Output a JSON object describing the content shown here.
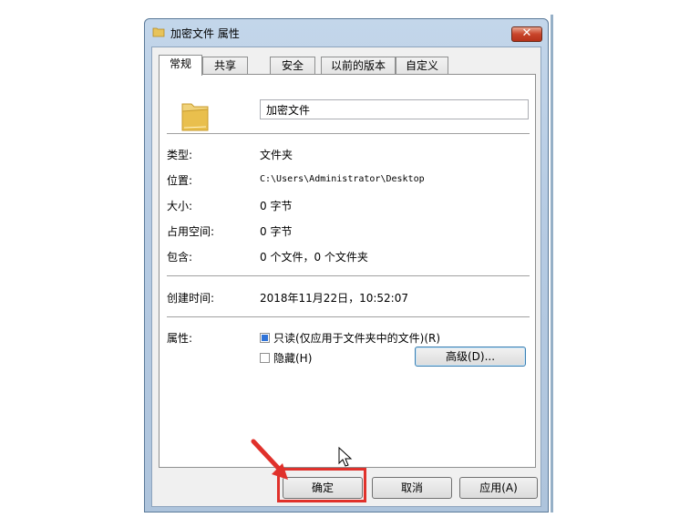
{
  "window": {
    "title": "加密文件 属性",
    "close_label": "✕"
  },
  "tabs": [
    {
      "label": "常规"
    },
    {
      "label": "共享"
    },
    {
      "label": "安全"
    },
    {
      "label": "以前的版本"
    },
    {
      "label": "自定义"
    }
  ],
  "general": {
    "folder_name": "加密文件",
    "type_label": "类型:",
    "type_value": "文件夹",
    "location_label": "位置:",
    "location_value": "C:\\Users\\Administrator\\Desktop",
    "size_label": "大小:",
    "size_value": "0 字节",
    "size_on_disk_label": "占用空间:",
    "size_on_disk_value": "0 字节",
    "contains_label": "包含:",
    "contains_value": "0 个文件，0 个文件夹",
    "created_label": "创建时间:",
    "created_value": "2018年11月22日，10:52:07",
    "attributes_label": "属性:",
    "readonly_label": "只读(仅应用于文件夹中的文件)(R)",
    "readonly_state": "indeterminate",
    "hidden_label": "隐藏(H)",
    "hidden_state": "unchecked",
    "advanced_label": "高级(D)..."
  },
  "footer": {
    "ok_label": "确定",
    "cancel_label": "取消",
    "apply_label": "应用(A)"
  },
  "colors": {
    "highlight": "#e0312b",
    "titlebar": "#b9cee6",
    "checkbox_fill": "#2f73d8"
  }
}
